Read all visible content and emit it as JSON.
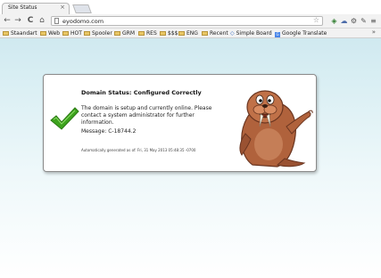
{
  "tab": {
    "title": "Site Status",
    "close": "×"
  },
  "toolbar": {
    "back": "←",
    "forward": "→",
    "reload": "C",
    "home": "⌂",
    "url": "eyodomo.com",
    "star": "☆",
    "extensions": [
      "◈",
      "☁",
      "⚙",
      "✎",
      "≡"
    ]
  },
  "bookmarks": [
    {
      "label": "Staandart",
      "icon": "folder-icon"
    },
    {
      "label": "Web",
      "icon": "folder-icon"
    },
    {
      "label": "HOT",
      "icon": "folder-icon"
    },
    {
      "label": "Spooler",
      "icon": "folder-icon"
    },
    {
      "label": "GRM",
      "icon": "folder-icon"
    },
    {
      "label": "RES",
      "icon": "folder-icon"
    },
    {
      "label": "$$$",
      "icon": "folder-icon"
    },
    {
      "label": "ENG",
      "icon": "folder-icon"
    },
    {
      "label": "Recent",
      "icon": "folder-icon"
    },
    {
      "label": "Simple Board",
      "icon": "bookmark-icon"
    },
    {
      "label": "Google Translate",
      "icon": "translate-icon"
    }
  ],
  "bookmarks_more": "»",
  "status": {
    "title": "Domain Status: Configured Correctly",
    "description": "The domain is setup and currently online. Please contact a system administrator for further information.",
    "message": "Message: C-18744.2",
    "generated": "Automatically generated as of: Fri, 31 May 2013 05:48:35 -0700"
  },
  "colors": {
    "check_green": "#3da31e",
    "walrus_brown": "#b0623c",
    "page_gradient_top": "#d0e9f0"
  }
}
